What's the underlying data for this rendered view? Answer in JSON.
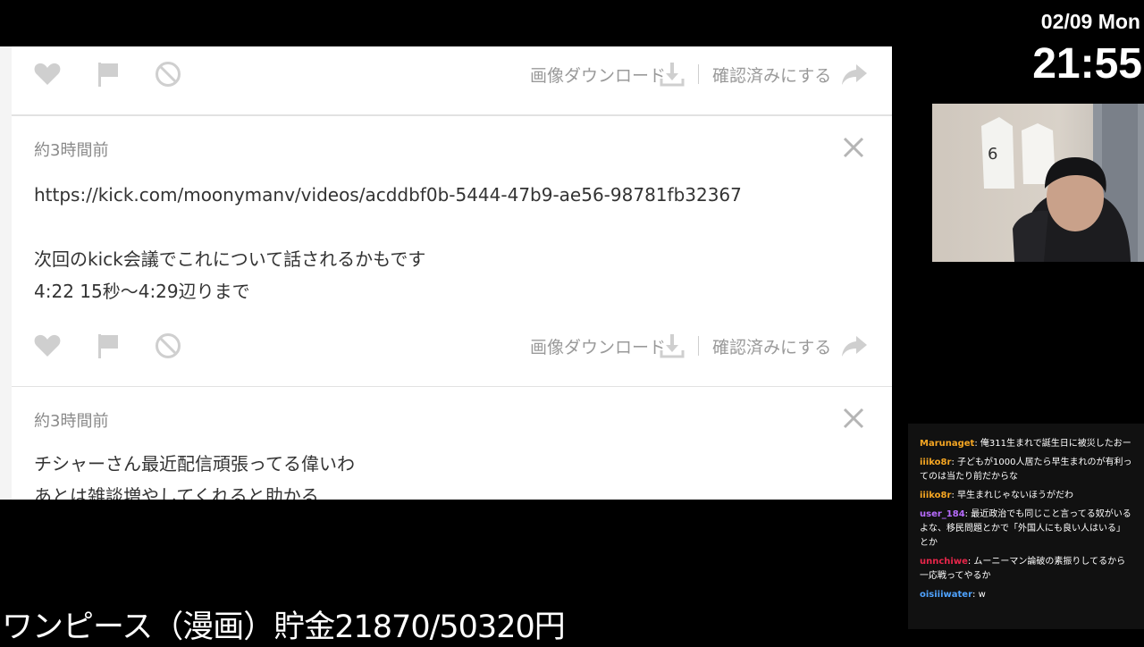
{
  "clock": {
    "date": "02/09 Mon",
    "time": "21:55"
  },
  "actions": {
    "download_label": "画像ダウンロード",
    "confirm_label": "確認済みにする"
  },
  "posts": [
    {
      "time": "約3時間前",
      "lines": [
        "https://kick.com/moonymanv/videos/acddbf0b-5444-47b9-ae56-98781fb32367",
        "",
        "次回のkick会議でこれについて話されるかもです",
        "4:22 15秒～4:29辺りまで"
      ]
    },
    {
      "time": "約3時間前",
      "lines": [
        "チシャーさん最近配信頑張ってる偉いわ",
        "あとは雑談増やしてくれると助かる"
      ]
    }
  ],
  "chat": {
    "messages": [
      {
        "user": "Marunaget",
        "color": "#f5a623",
        "text": "俺311生まれで誕生日に被災したおー"
      },
      {
        "user": "iiiko8r",
        "color": "#f5a623",
        "text": "子どもが1000人居たら早生まれのが有利ってのは当たり前だからな"
      },
      {
        "user": "iiiko8r",
        "color": "#f5a623",
        "text": "早生まれじゃないほうがだわ"
      },
      {
        "user": "user_184",
        "color": "#b86cff",
        "text": "最近政治でも同じこと言ってる奴がいるよな、移民問題とかで「外国人にも良い人はいる」とか"
      },
      {
        "user": "unnchiwe",
        "color": "#e8264a",
        "text": "ムーニーマン論破の素振りしてるから一応戦ってやるか"
      },
      {
        "user": "oisiiiwater",
        "color": "#4fa3ff",
        "text": "w"
      }
    ]
  },
  "ticker": {
    "text": "ワンピース（漫画）貯金21870/50320円"
  },
  "colors": {
    "icon_gray": "#c9c9c9",
    "text_gray": "#9a9a9a",
    "panel_bg": "#f4f4f4"
  }
}
